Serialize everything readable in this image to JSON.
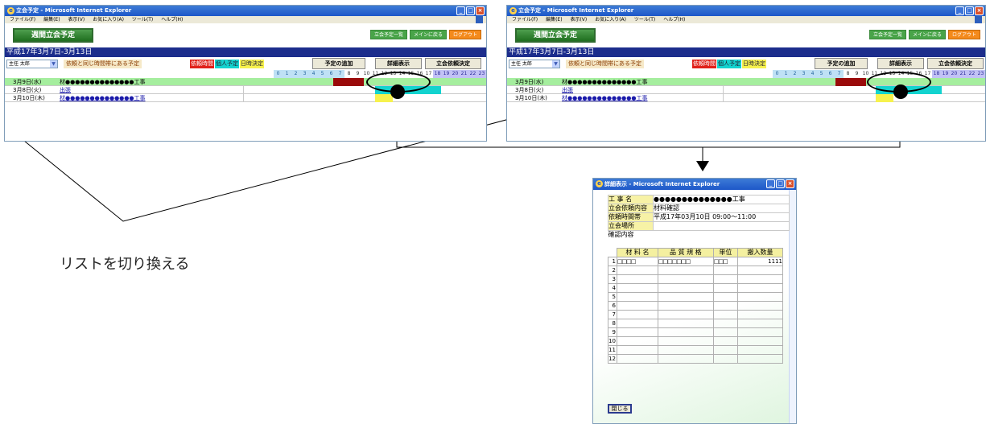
{
  "left_window": {
    "title": "立会予定 - Microsoft Internet Explorer",
    "menu": [
      "ファイル(F)",
      "編集(E)",
      "表示(V)",
      "お気に入り(A)",
      "ツール(T)",
      "ヘルプ(H)"
    ],
    "page_title": "週間立会予定",
    "header_buttons": [
      "立会予定一覧",
      "メインに戻る",
      "ログアウト"
    ],
    "date_range": "平成17年3月7日-3月13日",
    "select_value": "主任 太郎",
    "same_hours_label": "依頼と同じ時間帯にある予定",
    "legend": [
      "依頼時間",
      "個人予定",
      "日時決定"
    ],
    "add_button": "予定の追加",
    "detail_button": "詳細表示",
    "decide_button": "立会依頼決定",
    "hours": [
      "0",
      "1",
      "2",
      "3",
      "4",
      "5",
      "6",
      "7",
      "8",
      "9",
      "10",
      "11",
      "12",
      "13",
      "14",
      "15",
      "16",
      "17",
      "18",
      "19",
      "20",
      "21",
      "22",
      "23"
    ],
    "rows": [
      {
        "date": "3月9日(水)",
        "name": "材●●●●●●●●●●●●●●工事"
      },
      {
        "date": "3月8日(火)",
        "name": "出張"
      },
      {
        "date": "3月10日(木)",
        "name": "材●●●●●●●●●●●●●●工事"
      }
    ]
  },
  "right_window": {
    "title": "立会予定 - Microsoft Internet Explorer",
    "menu": [
      "ファイル(F)",
      "編集(E)",
      "表示(V)",
      "お気に入り(A)",
      "ツール(T)",
      "ヘルプ(H)"
    ],
    "page_title": "週間立会予定",
    "header_buttons": [
      "立会予定一覧",
      "メインに戻る",
      "ログアウト"
    ],
    "date_range": "平成17年3月7日-3月13日",
    "select_value": "主任 太郎",
    "same_hours_label": "依頼と同じ時間帯にある予定",
    "legend": [
      "依頼時間",
      "個人予定",
      "日時決定"
    ],
    "add_button": "予定の追加",
    "detail_button": "詳細表示",
    "decide_button": "立会依頼決定",
    "hours": [
      "0",
      "1",
      "2",
      "3",
      "4",
      "5",
      "6",
      "7",
      "8",
      "9",
      "10",
      "11",
      "12",
      "13",
      "14",
      "15",
      "16",
      "17",
      "18",
      "19",
      "20",
      "21",
      "22",
      "23"
    ],
    "rows": [
      {
        "date": "3月9日(水)",
        "name": "材●●●●●●●●●●●●●●工事"
      },
      {
        "date": "3月8日(火)",
        "name": "出張"
      },
      {
        "date": "3月10日(木)",
        "name": "材●●●●●●●●●●●●●●工事"
      }
    ]
  },
  "detail_window": {
    "title": "詳細表示 - Microsoft Internet Explorer",
    "fields": [
      {
        "label": "工 事 名",
        "value": "●●●●●●●●●●●●●●工事"
      },
      {
        "label": "立会依頼内容",
        "value": "材料確認"
      },
      {
        "label": "依頼時間帯",
        "value": "平成17年03月10日 09:00～11:00"
      },
      {
        "label": "立会場所",
        "value": ""
      },
      {
        "label": "確認内容",
        "value": ""
      }
    ],
    "material_headers": [
      "材 料 名",
      "品 質 規 格",
      "単位",
      "搬入数量"
    ],
    "material_rows": [
      {
        "n": "1",
        "name": "□□□□",
        "spec": "□□□□□□□",
        "unit": "□□□",
        "qty": "1111"
      },
      {
        "n": "2",
        "name": "",
        "spec": "",
        "unit": "",
        "qty": ""
      },
      {
        "n": "3",
        "name": "",
        "spec": "",
        "unit": "",
        "qty": ""
      },
      {
        "n": "4",
        "name": "",
        "spec": "",
        "unit": "",
        "qty": ""
      },
      {
        "n": "5",
        "name": "",
        "spec": "",
        "unit": "",
        "qty": ""
      },
      {
        "n": "6",
        "name": "",
        "spec": "",
        "unit": "",
        "qty": ""
      },
      {
        "n": "7",
        "name": "",
        "spec": "",
        "unit": "",
        "qty": ""
      },
      {
        "n": "8",
        "name": "",
        "spec": "",
        "unit": "",
        "qty": ""
      },
      {
        "n": "9",
        "name": "",
        "spec": "",
        "unit": "",
        "qty": ""
      },
      {
        "n": "10",
        "name": "",
        "spec": "",
        "unit": "",
        "qty": ""
      },
      {
        "n": "11",
        "name": "",
        "spec": "",
        "unit": "",
        "qty": ""
      },
      {
        "n": "12",
        "name": "",
        "spec": "",
        "unit": "",
        "qty": ""
      }
    ],
    "close_button": "閉じる"
  },
  "caption": "リストを切り換える",
  "colors": {
    "datebar": "#1c2d8c",
    "highlight_row": "#a5ee9e",
    "request_time": "#e0211a",
    "personal": "#13d3cf",
    "fixed": "#f7f24d",
    "block_dark_red": "#9a0a0a"
  }
}
